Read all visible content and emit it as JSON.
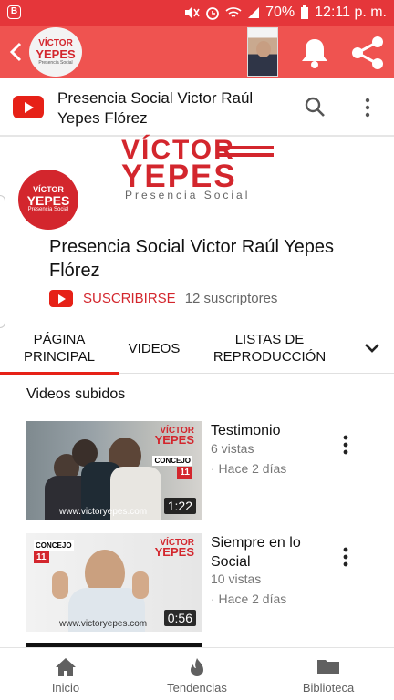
{
  "status_bar": {
    "battery": "70%",
    "time": "12:11 p. m.",
    "left_badge": "B"
  },
  "app_bar": {
    "logo_line1": "VÍCTOR",
    "logo_line2": "YEPES",
    "logo_line3": "Presencia Social"
  },
  "youtube_header": {
    "title": "Presencia Social Victor Raúl Yepes Flórez"
  },
  "banner": {
    "line1": "VÍCTOR",
    "line2": "YEPES",
    "subtitle": "Presencia Social"
  },
  "channel": {
    "avatar_line1": "VÍCTOR",
    "avatar_line2": "YEPES",
    "avatar_line3": "Presencia Social",
    "name": "Presencia Social Victor Raúl Yepes Flórez",
    "subscribe_label": "SUSCRIBIRSE",
    "subscribers": "12 suscriptores"
  },
  "tabs": [
    {
      "label": "PÁGINA PRINCIPAL"
    },
    {
      "label": "VIDEOS"
    },
    {
      "label": "LISTAS DE REPRODUCCIÓN"
    }
  ],
  "section_title": "Videos subidos",
  "videos": [
    {
      "title": "Testimonio",
      "views": "6 vistas",
      "ago": "· Hace 2 días",
      "duration": "1:22",
      "url": "www.victoryepes.com",
      "concejo": "CONCEJO",
      "number": "11"
    },
    {
      "title": "Siempre en lo Social",
      "views": "10 vistas",
      "ago": "· Hace 2 días",
      "duration": "0:56",
      "url": "www.victoryepes.com",
      "concejo": "CONCEJO",
      "number": "11"
    }
  ],
  "bottom_nav": [
    {
      "label": "Inicio",
      "icon": "home-icon"
    },
    {
      "label": "Tendencias",
      "icon": "flame-icon"
    },
    {
      "label": "Biblioteca",
      "icon": "folder-icon"
    }
  ],
  "colors": {
    "status_bar": "#e5363a",
    "app_bar": "#ef5350",
    "brand_red": "#d3262d",
    "youtube_red": "#e62117"
  }
}
